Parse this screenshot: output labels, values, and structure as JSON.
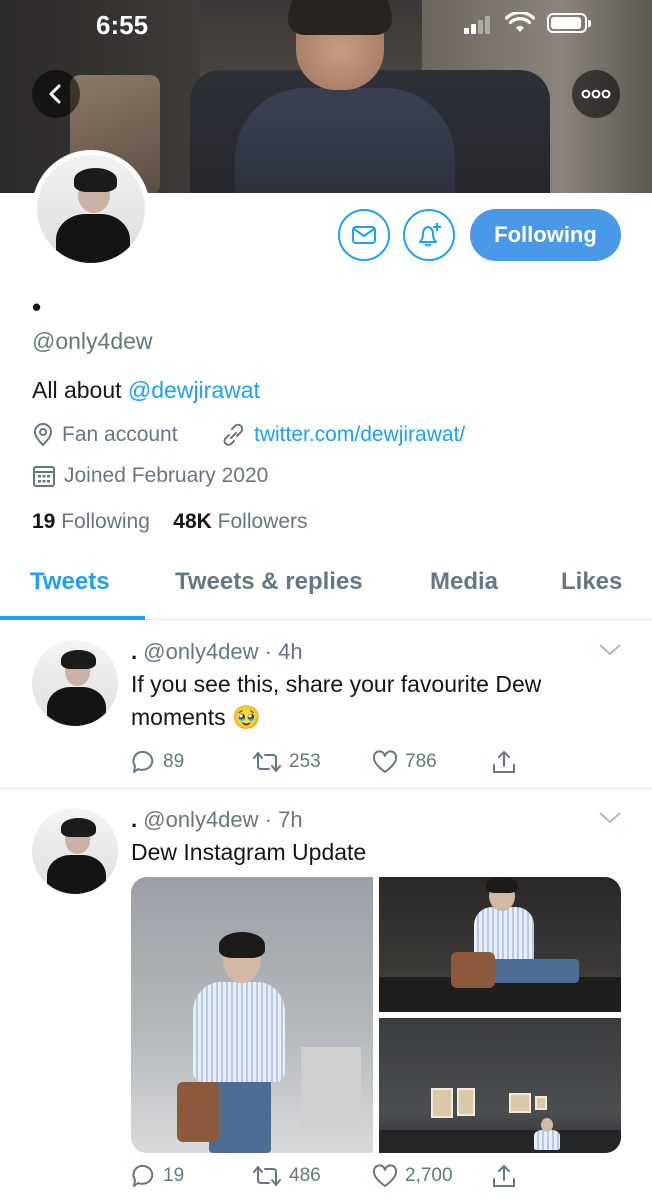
{
  "status_bar": {
    "time": "6:55"
  },
  "profile": {
    "display_name": "•",
    "handle": "@only4dew",
    "bio_prefix": "All about ",
    "bio_mention": "@dewjirawat",
    "location": "Fan account",
    "link": "twitter.com/dewjirawat/",
    "joined": "Joined February 2020",
    "following_count": "19",
    "following_label": "Following",
    "followers_count": "48K",
    "followers_label": "Followers",
    "follow_button_label": "Following"
  },
  "tabs": [
    {
      "label": "Tweets",
      "active": true
    },
    {
      "label": "Tweets & replies",
      "active": false
    },
    {
      "label": "Media",
      "active": false
    },
    {
      "label": "Likes",
      "active": false
    }
  ],
  "tweets": [
    {
      "name": ".",
      "handle": "@only4dew",
      "time": "4h",
      "text_line1": "If you see this, share your favourite Dew",
      "text_line2": "moments",
      "emoji": "🥹",
      "replies": "89",
      "retweets": "253",
      "likes": "786"
    },
    {
      "name": ".",
      "handle": "@only4dew",
      "time": "7h",
      "text": "Dew Instagram Update",
      "replies": "19",
      "retweets": "486",
      "likes": "2,700"
    }
  ],
  "colors": {
    "accent": "#1da1f2",
    "follow_button": "#4a99e9",
    "muted": "#657786"
  },
  "icons": [
    "back-arrow-icon",
    "more-icon",
    "mail-icon",
    "bell-plus-icon",
    "location-pin-icon",
    "link-icon",
    "calendar-icon",
    "reply-icon",
    "retweet-icon",
    "like-icon",
    "share-icon",
    "chevron-down-icon"
  ]
}
